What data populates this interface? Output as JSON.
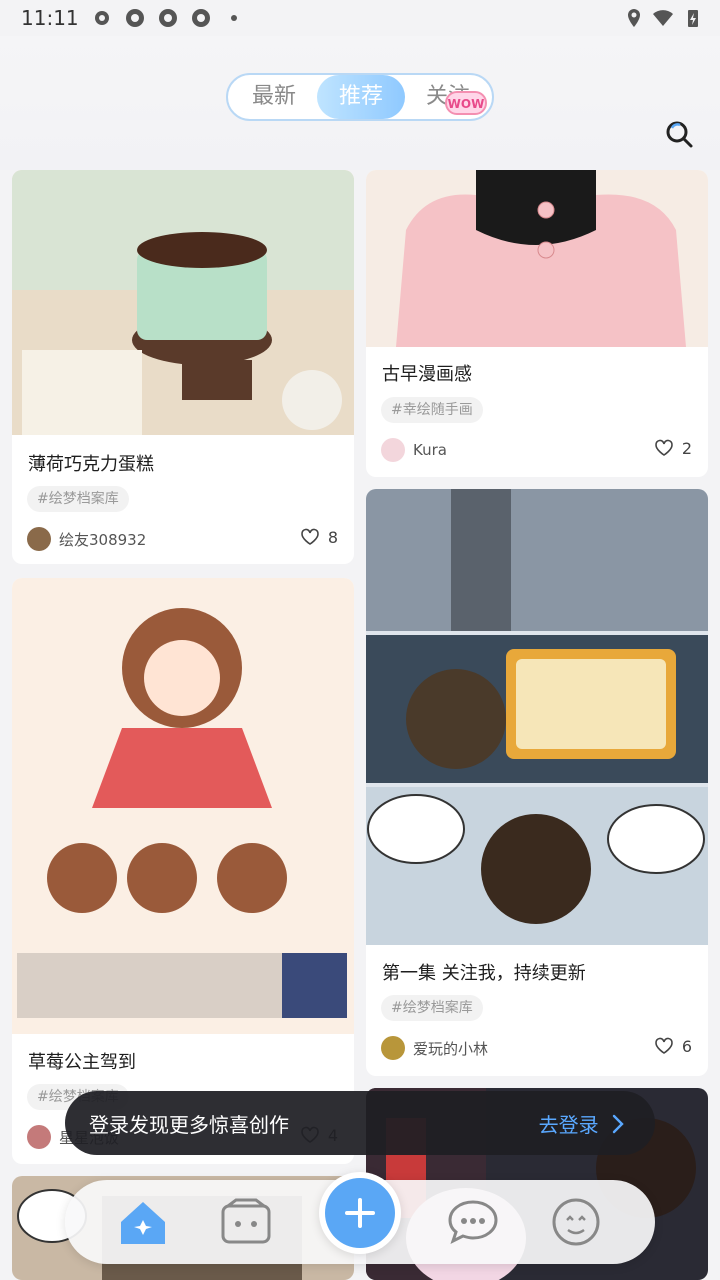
{
  "status_bar": {
    "time": "11:11"
  },
  "header": {
    "tabs": [
      {
        "label": "最新"
      },
      {
        "label": "推荐"
      },
      {
        "label": "关注"
      }
    ],
    "badge": "WOW"
  },
  "feed": {
    "left": [
      {
        "title": "薄荷巧克力蛋糕",
        "tag": "#绘梦档案库",
        "author": "绘友308932",
        "likes": "8"
      },
      {
        "title": "草莓公主驾到",
        "tag": "#绘梦档案库",
        "author": "星星泡饭",
        "likes": "4"
      }
    ],
    "right": [
      {
        "title": "古早漫画感",
        "tag": "#幸绘随手画",
        "author": "Kura",
        "likes": "2"
      },
      {
        "title": "第一集 关注我，持续更新",
        "tag": "#绘梦档案库",
        "author": "爱玩的小林",
        "likes": "6"
      }
    ]
  },
  "login_toast": {
    "text": "登录发现更多惊喜创作",
    "action": "去登录"
  },
  "colors": {
    "accent": "#5aa7f5",
    "tab_border": "#b9d8f5"
  }
}
